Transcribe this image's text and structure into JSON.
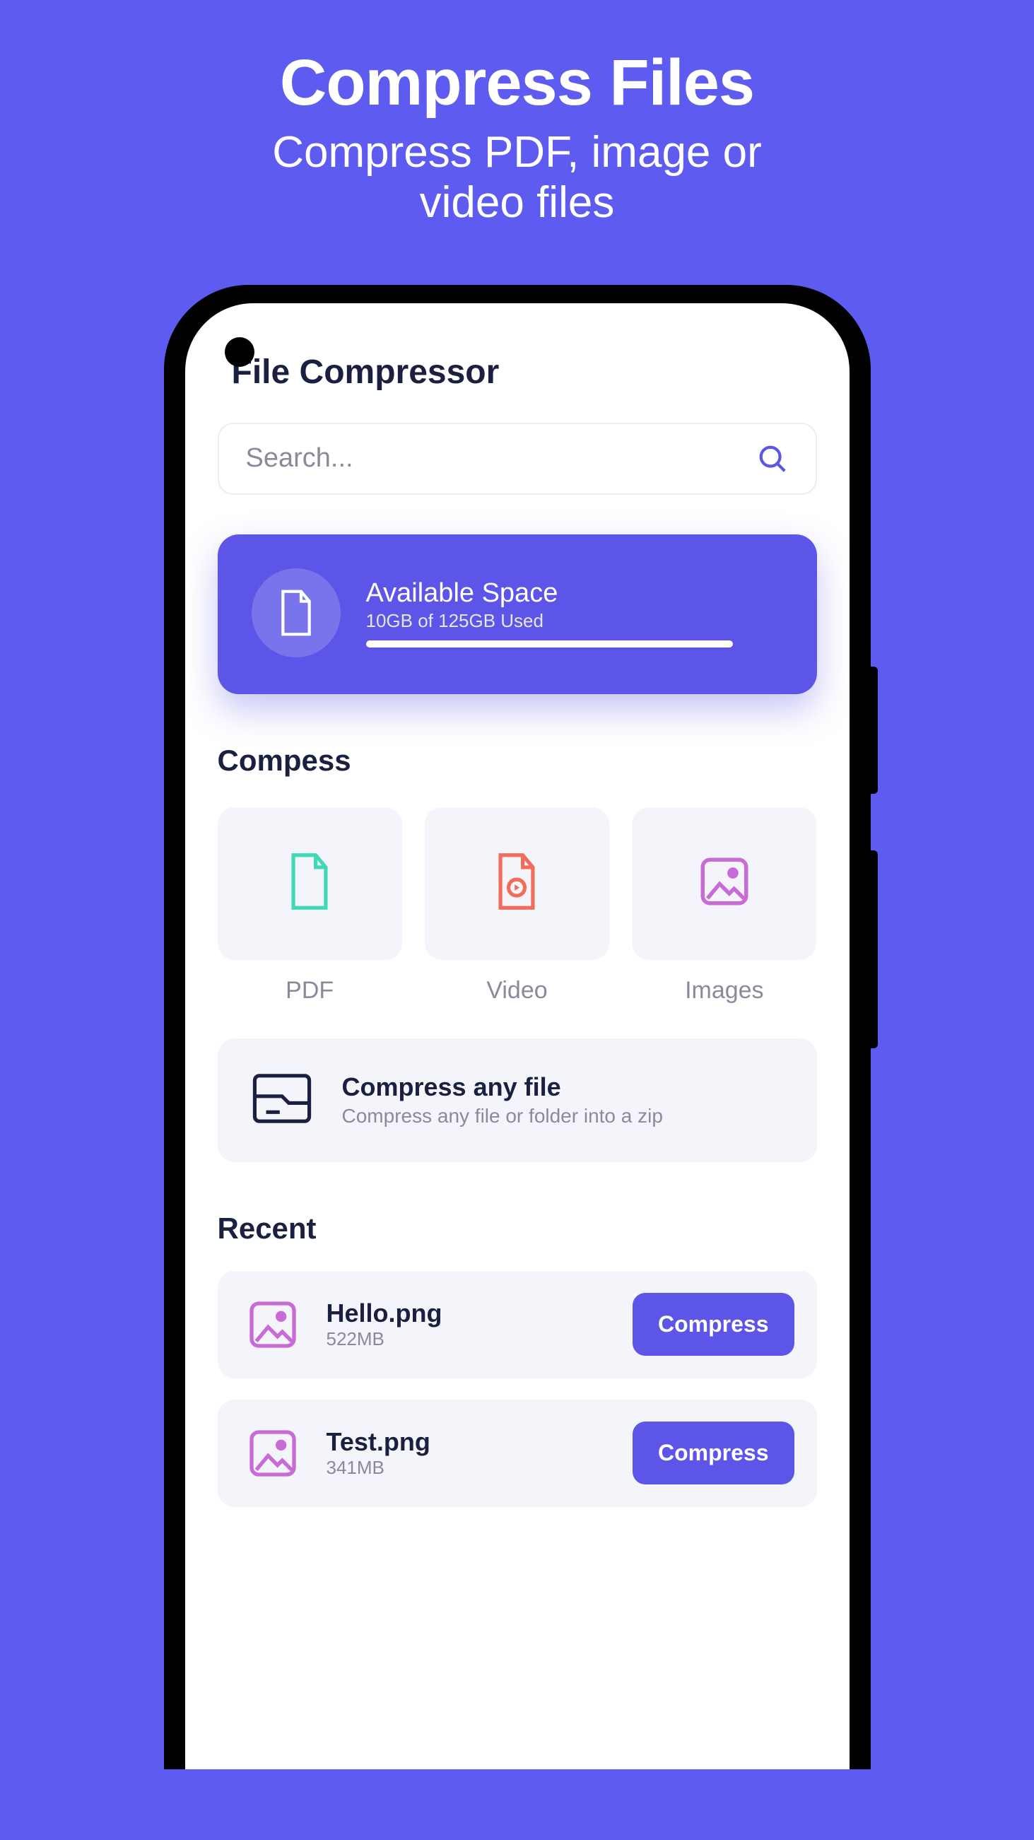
{
  "header": {
    "title": "Compress Files",
    "subtitle_line1": "Compress PDF, image or",
    "subtitle_line2": "video files"
  },
  "app": {
    "title": "File Compressor",
    "search": {
      "placeholder": "Search..."
    },
    "space": {
      "title": "Available Space",
      "sub": "10GB of 125GB Used"
    },
    "compress_section": {
      "title": "Compess",
      "options": [
        {
          "label": "PDF"
        },
        {
          "label": "Video"
        },
        {
          "label": "Images"
        }
      ],
      "any_file": {
        "title": "Compress any file",
        "sub": "Compress any file or folder into a zip"
      }
    },
    "recent": {
      "title": "Recent",
      "items": [
        {
          "name": "Hello.png",
          "size": "522MB",
          "action": "Compress"
        },
        {
          "name": "Test.png",
          "size": "341MB",
          "action": "Compress"
        }
      ]
    }
  }
}
